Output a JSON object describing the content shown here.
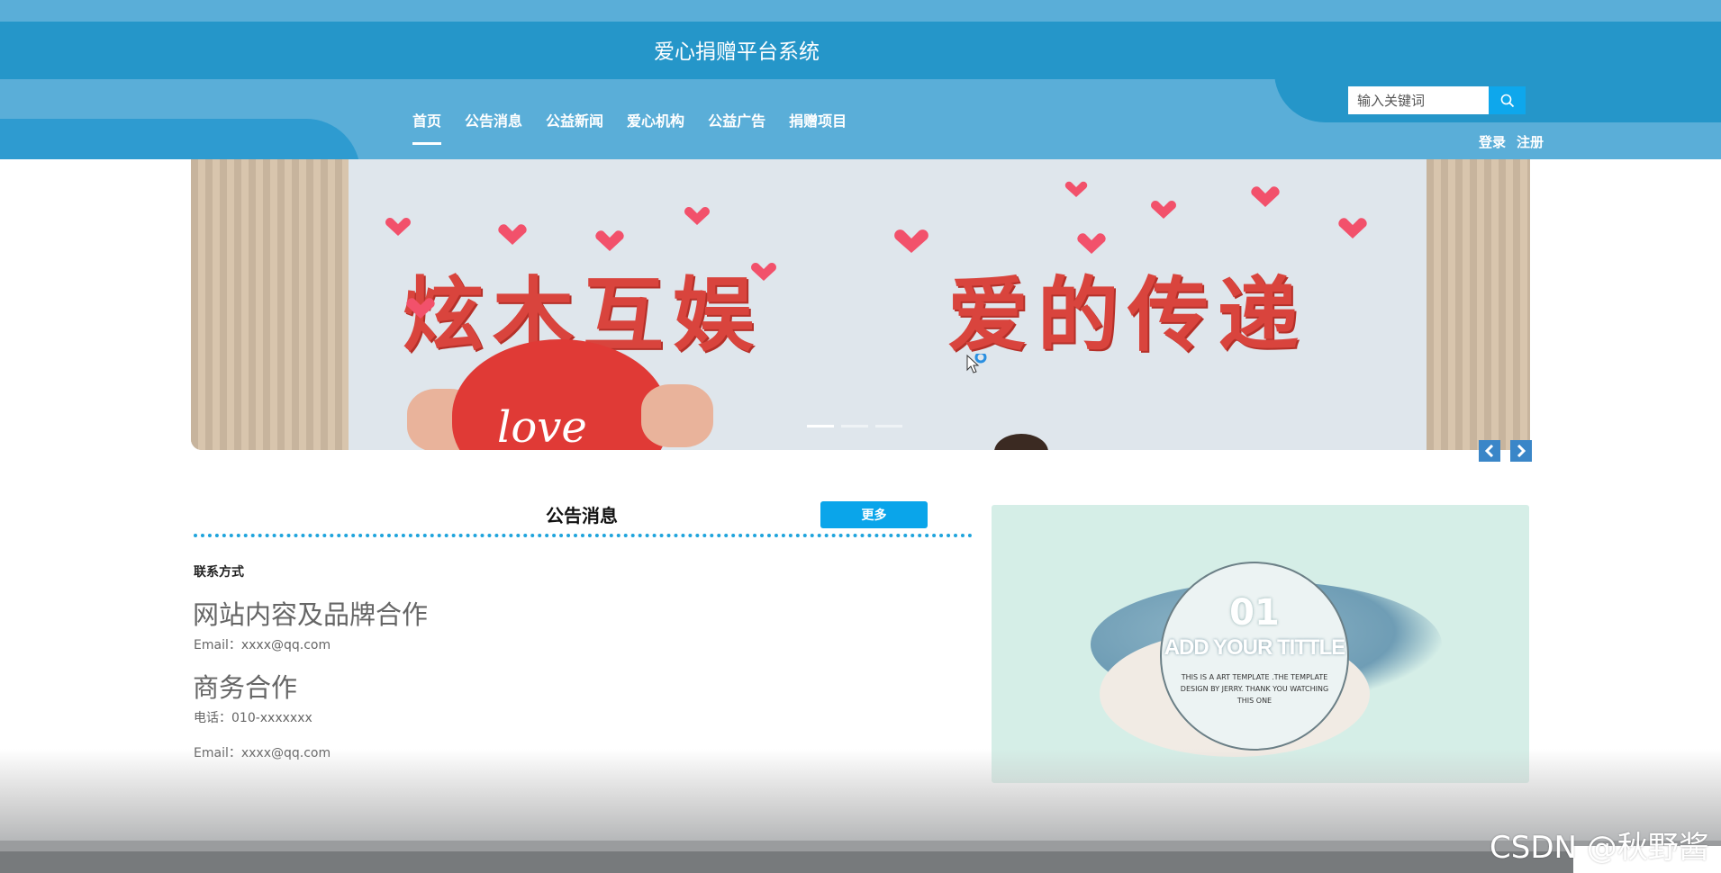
{
  "header": {
    "site_title": "爱心捐赠平台系统",
    "nav": [
      {
        "label": "首页",
        "active": true
      },
      {
        "label": "公告消息",
        "active": false
      },
      {
        "label": "公益新闻",
        "active": false
      },
      {
        "label": "爱心机构",
        "active": false
      },
      {
        "label": "公益广告",
        "active": false
      },
      {
        "label": "捐赠项目",
        "active": false
      }
    ],
    "search": {
      "placeholder": "输入关键词",
      "value": ""
    },
    "auth": {
      "login": "登录",
      "register": "注册"
    }
  },
  "banner": {
    "slogan_left": "炫木互娱",
    "slogan_right": "爱的传递",
    "heart_text": "love",
    "slide_count": 3,
    "active_slide": 1
  },
  "notice": {
    "title": "公告消息",
    "more_label": "更多",
    "contact_label": "联系方式",
    "group1_title": "网站内容及品牌合作",
    "group1_email": "Email：xxxx@qq.com",
    "group2_title": "商务合作",
    "group2_phone": "电话：010-xxxxxxx",
    "group2_email": "Email：xxxx@qq.com"
  },
  "promo": {
    "number": "01",
    "title": "ADD YOUR TITTLE",
    "description": "THIS IS A ART TEMPLATE .THE TEMPLATE DESIGN BY JERRY. THANK YOU WATCHING THIS ONE"
  },
  "watermark": "CSDN @秋野酱",
  "colors": {
    "header_bg": "#5aaed8",
    "header_band": "#2596c9",
    "accent": "#0aa5ea",
    "promo_bg": "#d5eee7"
  }
}
